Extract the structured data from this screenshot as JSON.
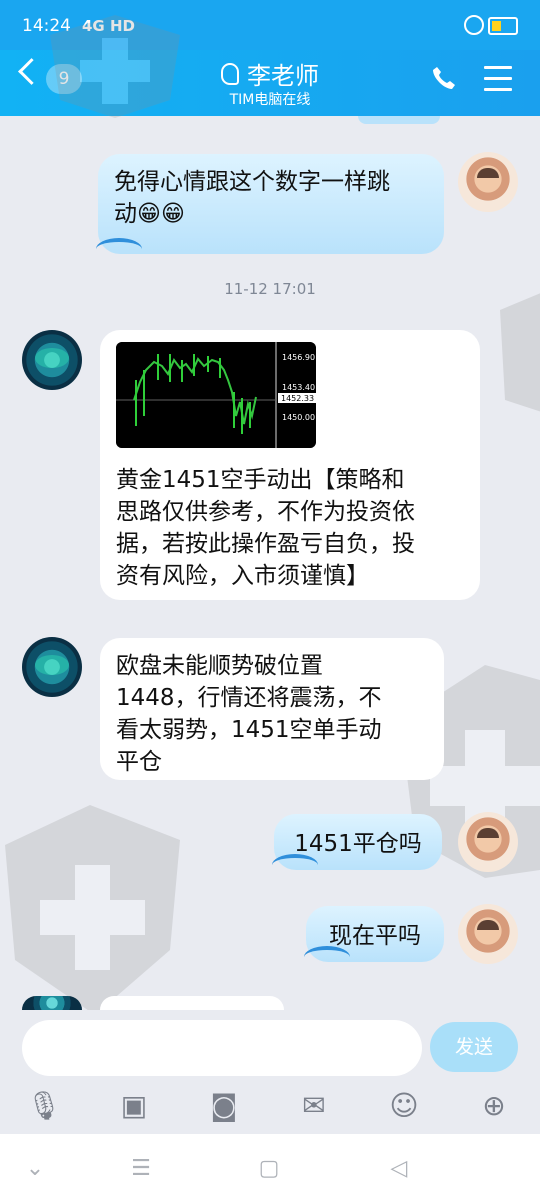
{
  "status_bar": {
    "time": "14:24",
    "network": "4G HD"
  },
  "header": {
    "back_badge": "9",
    "contact_name": "李老师",
    "contact_status": "TIM电脑在线"
  },
  "messages": [
    {
      "side": "right",
      "text_line1": "免得心情跟这个数字一样跳",
      "text_line2": "动😁😁"
    },
    {
      "timestamp": "11-12 17:01"
    },
    {
      "side": "left",
      "chart_labels": [
        "1456.90",
        "1453.40",
        "1452.33",
        "1450.00"
      ],
      "lines": [
        "黄金1451空手动出【策略和",
        "思路仅供参考，不作为投资依",
        "据，若按此操作盈亏自负，投",
        "资有风险，入市须谨慎】"
      ]
    },
    {
      "side": "left",
      "lines": [
        "欧盘未能顺势破位置",
        "1448，行情还将震荡，不",
        "看太弱势，1451空单手动",
        "平仓"
      ]
    },
    {
      "side": "right",
      "text": "1451平仓吗"
    },
    {
      "side": "right",
      "text": "现在平吗"
    }
  ],
  "composer": {
    "placeholder": "",
    "send_label": "发送"
  }
}
